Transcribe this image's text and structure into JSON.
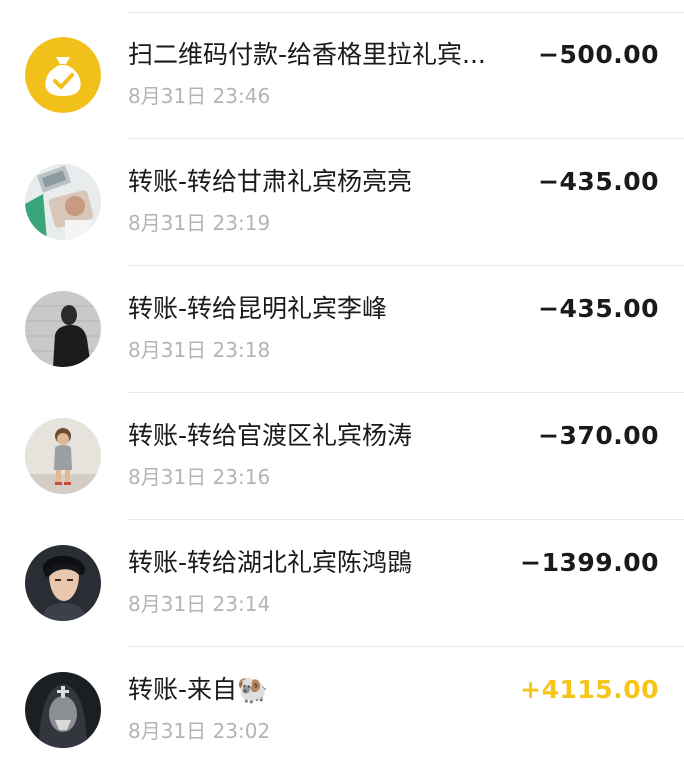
{
  "colors": {
    "text_primary": "#1a1a1a",
    "text_secondary": "#b4b4b4",
    "positive_amount": "#f5c518",
    "qr_avatar_bg": "#f2c01b"
  },
  "transactions": [
    {
      "title": "扫二维码付款-给香格里拉礼宾...",
      "time": "8月31日 23:46",
      "amount": "−500.00",
      "avatar_icon": "money-bag-check-icon"
    },
    {
      "title": "转账-转给甘肃礼宾杨亮亮",
      "time": "8月31日 23:19",
      "amount": "−435.00",
      "avatar_icon": "user-photo-avatar"
    },
    {
      "title": "转账-转给昆明礼宾李峰",
      "time": "8月31日 23:18",
      "amount": "−435.00",
      "avatar_icon": "user-photo-avatar"
    },
    {
      "title": "转账-转给官渡区礼宾杨涛",
      "time": "8月31日 23:16",
      "amount": "−370.00",
      "avatar_icon": "user-photo-avatar"
    },
    {
      "title": "转账-转给湖北礼宾陈鸿鵾",
      "time": "8月31日 23:14",
      "amount": "−1399.00",
      "avatar_icon": "user-photo-avatar"
    },
    {
      "title": "转账-来自🐏",
      "time": "8月31日 23:02",
      "amount": "+4115.00",
      "avatar_icon": "user-photo-avatar"
    }
  ]
}
